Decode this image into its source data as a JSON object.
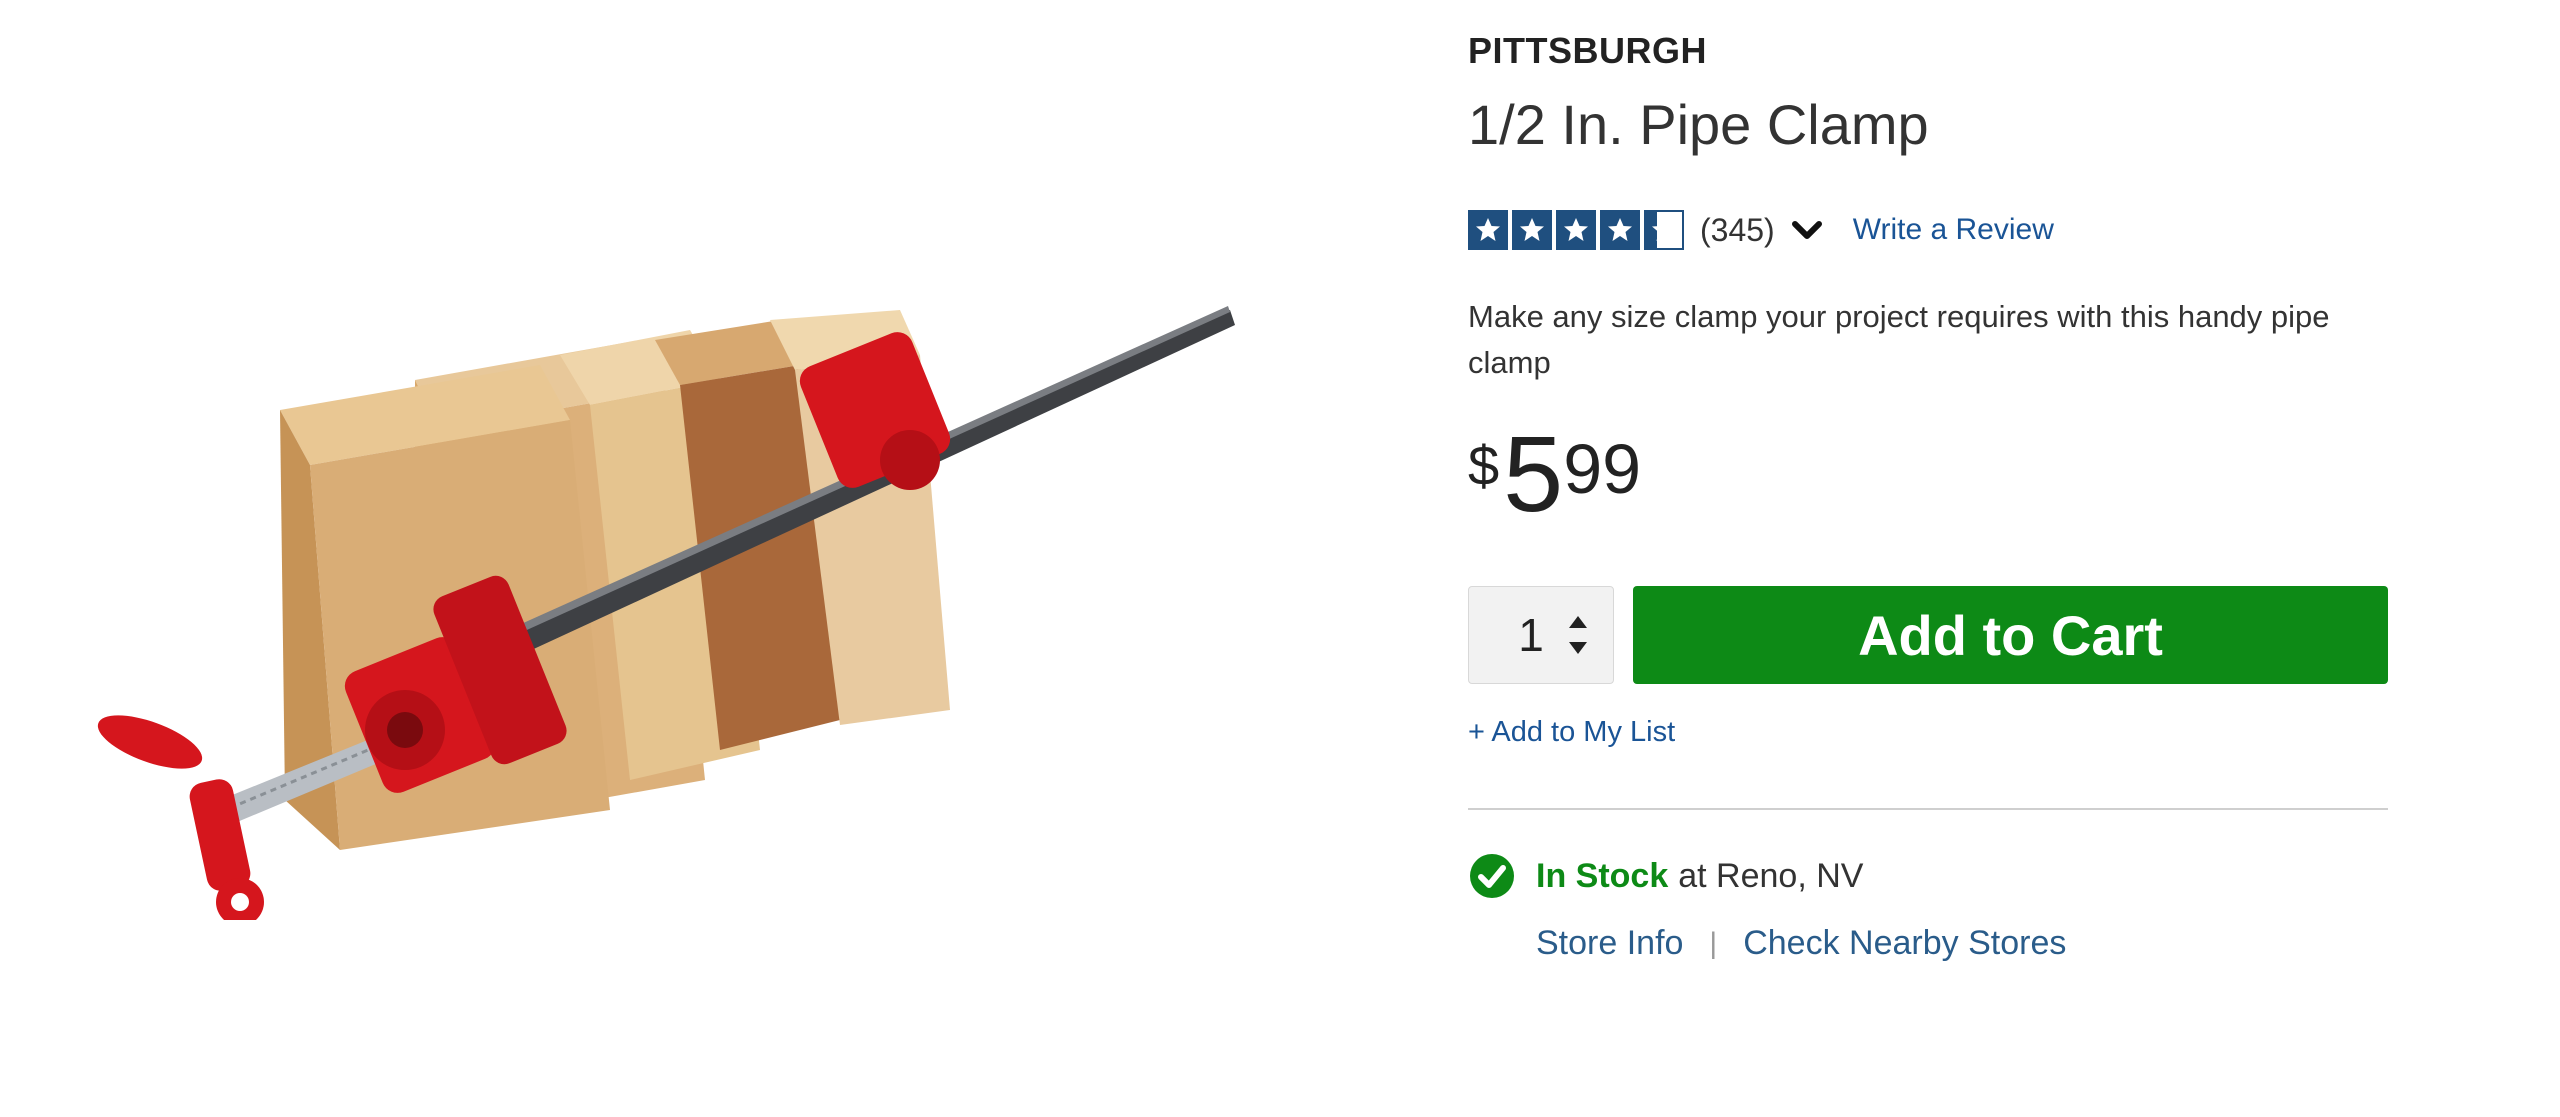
{
  "product": {
    "brand": "PITTSBURGH",
    "title": "1/2 In. Pipe Clamp",
    "description": "Make any size clamp your project requires with this handy pipe clamp",
    "image_icon": "pipe-clamp-product-image"
  },
  "rating": {
    "value": 4.3,
    "max": 5,
    "count_text": "(345)",
    "write_review_label": "Write a Review",
    "star_color": "#1f4f7f"
  },
  "price": {
    "currency": "$",
    "dollars": "5",
    "cents": "99"
  },
  "cart": {
    "quantity": "1",
    "add_to_cart_label": "Add to Cart",
    "add_to_list_label": "+ Add to My List",
    "button_color": "#0d8a16"
  },
  "stock": {
    "status": "In Stock",
    "location_text": "at Reno, NV",
    "store_info_label": "Store Info",
    "separator": "|",
    "nearby_label": "Check Nearby Stores"
  }
}
